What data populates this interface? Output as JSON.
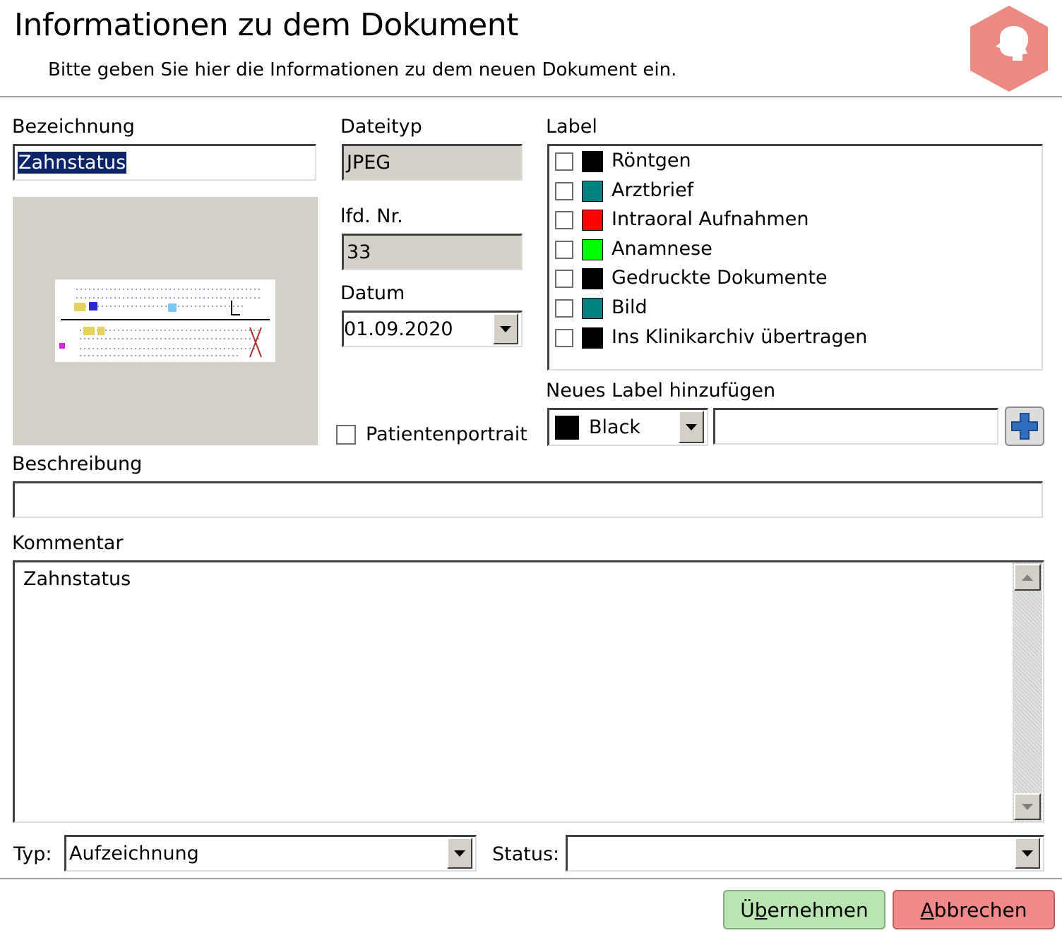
{
  "header": {
    "title": "Informationen zu dem Dokument",
    "subtitle": "Bitte geben Sie hier die Informationen zu dem neuen Dokument ein."
  },
  "bezeichnung": {
    "label": "Bezeichnung",
    "value": "Zahnstatus"
  },
  "dateityp": {
    "label": "Dateityp",
    "value": "JPEG"
  },
  "lfd_nr": {
    "label": "lfd. Nr.",
    "value": "33"
  },
  "datum": {
    "label": "Datum",
    "value": "01.09.2020"
  },
  "patientenportrait": {
    "label": "Patientenportrait",
    "checked": false
  },
  "labels": {
    "title": "Label",
    "items": [
      {
        "name": "Röntgen",
        "color": "#000000",
        "checked": false
      },
      {
        "name": "Arztbrief",
        "color": "#008080",
        "checked": false
      },
      {
        "name": "Intraoral Aufnahmen",
        "color": "#ff0000",
        "checked": false
      },
      {
        "name": "Anamnese",
        "color": "#00ff00",
        "checked": false
      },
      {
        "name": "Gedruckte Dokumente",
        "color": "#000000",
        "checked": false
      },
      {
        "name": "Bild",
        "color": "#008080",
        "checked": false
      },
      {
        "name": "Ins Klinikarchiv übertragen",
        "color": "#000000",
        "checked": false
      }
    ]
  },
  "new_label": {
    "title": "Neues Label hinzufügen",
    "color_name": "Black",
    "color": "#000000",
    "name_value": ""
  },
  "beschreibung": {
    "label": "Beschreibung",
    "value": ""
  },
  "kommentar": {
    "label": "Kommentar",
    "value": "Zahnstatus"
  },
  "typ": {
    "label": "Typ:",
    "value": "Aufzeichnung"
  },
  "status": {
    "label": "Status:",
    "value": ""
  },
  "buttons": {
    "apply_pre": "Ü",
    "apply_u": "b",
    "apply_post": "ernehmen",
    "cancel_u": "A",
    "cancel_post": "bbrechen"
  },
  "colors": {
    "accent_hex": "#e9847c",
    "apply_bg": "#b9e6b0",
    "cancel_bg": "#f08a8a",
    "readonly_bg": "#d4d0c8"
  }
}
